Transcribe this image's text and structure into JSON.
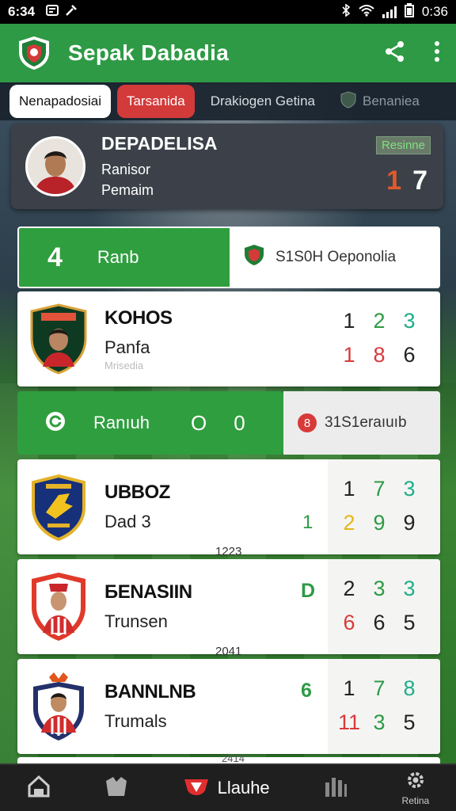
{
  "status": {
    "time": "6:34",
    "clock_right": "0:36"
  },
  "app": {
    "title": "Sepak Dabadia"
  },
  "tabs": [
    "Nenapadosiai",
    "Tarsanida",
    "Drakiogen Getina",
    "Benaniea"
  ],
  "profile": {
    "name": "DEPADELISA",
    "line1": "Ranisor",
    "line2": "Pemaim",
    "badge": "Resinne",
    "score_a": "1",
    "score_b": "7"
  },
  "bar1": {
    "number": "4",
    "label": "Ranb",
    "right_text": "S1S0H Oeponolia"
  },
  "card1": {
    "name": "KOHOS",
    "sub": "Panfa",
    "note": "Mrisedia",
    "grid": [
      "1",
      "2",
      "3",
      "1",
      "8",
      "6"
    ]
  },
  "bar2": {
    "label": "Ranıuh",
    "score_a": "O",
    "score_b": "0",
    "badge": "8",
    "right_text": "31S1eraıuıb"
  },
  "card2": {
    "name": "UBBOZ",
    "sub": "Dad 3",
    "extra": "1",
    "grid": [
      "1",
      "7",
      "3",
      "2",
      "9",
      "9"
    ]
  },
  "card3": {
    "above": "1223",
    "name": "ƂENASIIN",
    "sub": "Trunsen",
    "extra": "D",
    "grid": [
      "2",
      "3",
      "3",
      "6",
      "6",
      "5"
    ]
  },
  "card4": {
    "above": "2041",
    "name": "BANNLNB",
    "sub": "Trumals",
    "extra": "6",
    "grid": [
      "1",
      "7",
      "8",
      "11",
      "3",
      "5"
    ]
  },
  "bottom_nav": {
    "active_label": "Llauhe",
    "settings_label": "Retina",
    "peek_text": "2414"
  },
  "colors": {
    "primary": "#2e9a45",
    "accent_red": "#d33a3a"
  }
}
